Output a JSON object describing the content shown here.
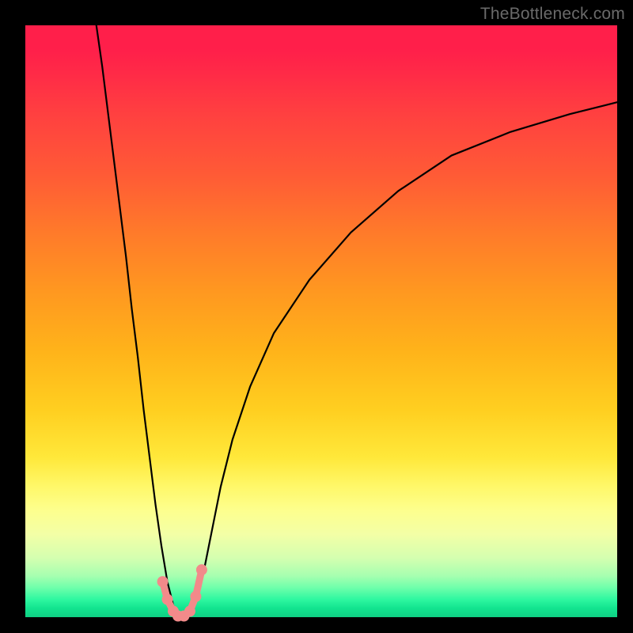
{
  "watermark": "TheBottleneck.com",
  "chart_data": {
    "type": "line",
    "title": "",
    "xlabel": "",
    "ylabel": "",
    "xlim": [
      0,
      100
    ],
    "ylim": [
      0,
      100
    ],
    "grid": false,
    "legend": false,
    "gradient_colors": {
      "top": "#ff1f4a",
      "upper_mid": "#ff9820",
      "lower_mid": "#fff86a",
      "bottom": "#12e48f"
    },
    "series": [
      {
        "name": "bottleneck-curve",
        "color": "#000000",
        "x": [
          12,
          13,
          14,
          15,
          16,
          17,
          18,
          19,
          20,
          21,
          22,
          23,
          24,
          25,
          26,
          27,
          28,
          29,
          30,
          31,
          32,
          33,
          35,
          38,
          42,
          48,
          55,
          63,
          72,
          82,
          92,
          100
        ],
        "y": [
          100,
          93,
          85,
          77,
          69,
          61,
          52,
          44,
          35,
          27,
          19,
          12,
          6,
          2,
          0,
          0,
          1,
          3,
          7,
          12,
          17,
          22,
          30,
          39,
          48,
          57,
          65,
          72,
          78,
          82,
          85,
          87
        ]
      },
      {
        "name": "marker-points",
        "type": "scatter",
        "color": "#f28a8a",
        "x": [
          23.2,
          24.0,
          25.0,
          25.8,
          26.8,
          27.8,
          28.8,
          29.8
        ],
        "y": [
          6.0,
          3.0,
          1.0,
          0.2,
          0.2,
          1.0,
          3.5,
          8.0
        ]
      }
    ],
    "notch_x": 26,
    "notch_y": 0
  },
  "plot": {
    "inner_left": 32,
    "inner_top": 32,
    "inner_size": 748
  }
}
